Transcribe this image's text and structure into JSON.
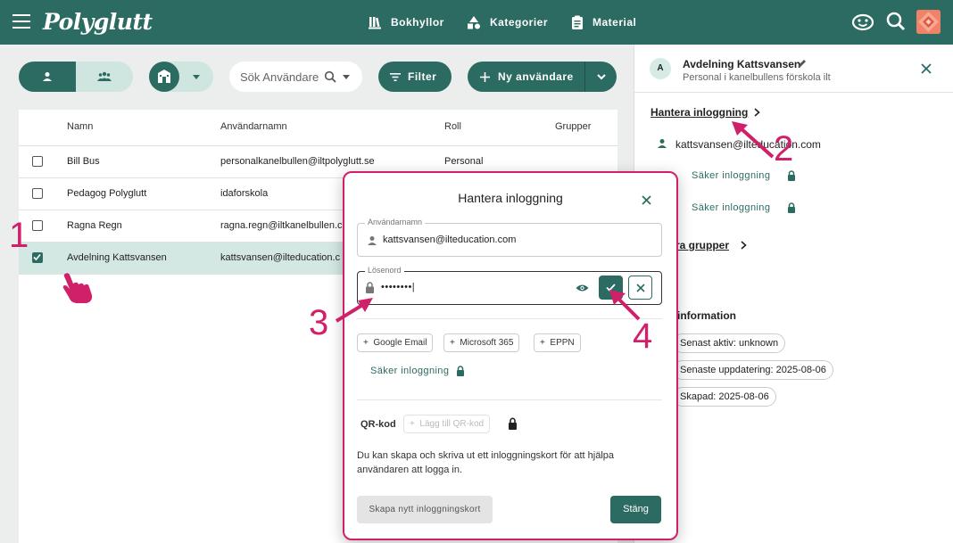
{
  "app": {
    "title": "Polyglutt"
  },
  "nav": {
    "bookshelves": "Bokhyllor",
    "categories": "Kategorier",
    "material": "Material"
  },
  "toolbar": {
    "search_placeholder": "Sök Användare",
    "filter_label": "Filter",
    "new_user_label": "Ny användare"
  },
  "table": {
    "headers": {
      "name": "Namn",
      "username": "Användarnamn",
      "role": "Roll",
      "groups": "Grupper"
    },
    "rows": [
      {
        "name": "Bill Bus",
        "username": "personalkanelbullen@iltpolyglutt.se",
        "role": "Personal",
        "selected": false
      },
      {
        "name": "Pedagog Polyglutt",
        "username": "idaforskola",
        "role": "",
        "selected": false
      },
      {
        "name": "Ragna Regn",
        "username": "ragna.regn@iltkanelbullen.c",
        "role": "",
        "selected": false
      },
      {
        "name": "Avdelning Kattsvansen",
        "username": "kattsvansen@ilteducation.c",
        "role": "",
        "selected": true
      }
    ]
  },
  "panel": {
    "avatar_letter": "A",
    "name": "Avdelning Kattsvansen",
    "subtitle": "Personal i kanelbullens förskola ilt",
    "manage_login": "Hantera inloggning",
    "email": "kattsvansen@ilteducation.com",
    "secure_login_1": "Säker inloggning",
    "secure_login_2": "Säker inloggning",
    "manage_groups_partial": "ra grupper",
    "info_heading_partial": "information",
    "last_active": "Senast aktiv: unknown",
    "last_updated": "Senaste uppdatering: 2025-08-06",
    "created": "Skapad: 2025-08-06"
  },
  "modal": {
    "title": "Hantera inloggning",
    "username_label": "Användarnamn",
    "username_value": "kattsvansen@ilteducation.com",
    "password_label": "Lösenord",
    "password_value": "••••••••|",
    "chips": [
      "Google Email",
      "Microsoft 365",
      "EPPN"
    ],
    "secure_login": "Säker inloggning",
    "qr_label": "QR-kod",
    "qr_add": "Lägg till QR-kod",
    "description": "Du kan skapa och skriva ut ett inloggningskort för att hjälpa användaren att logga in.",
    "create_card": "Skapa nytt inloggningskort",
    "close": "Stäng"
  },
  "annotations": {
    "step1": "1",
    "step2": "2",
    "step3": "3",
    "step4": "4"
  },
  "colors": {
    "primary": "#2c6b62",
    "light": "#cfe5e0",
    "annotation": "#d0206a"
  }
}
